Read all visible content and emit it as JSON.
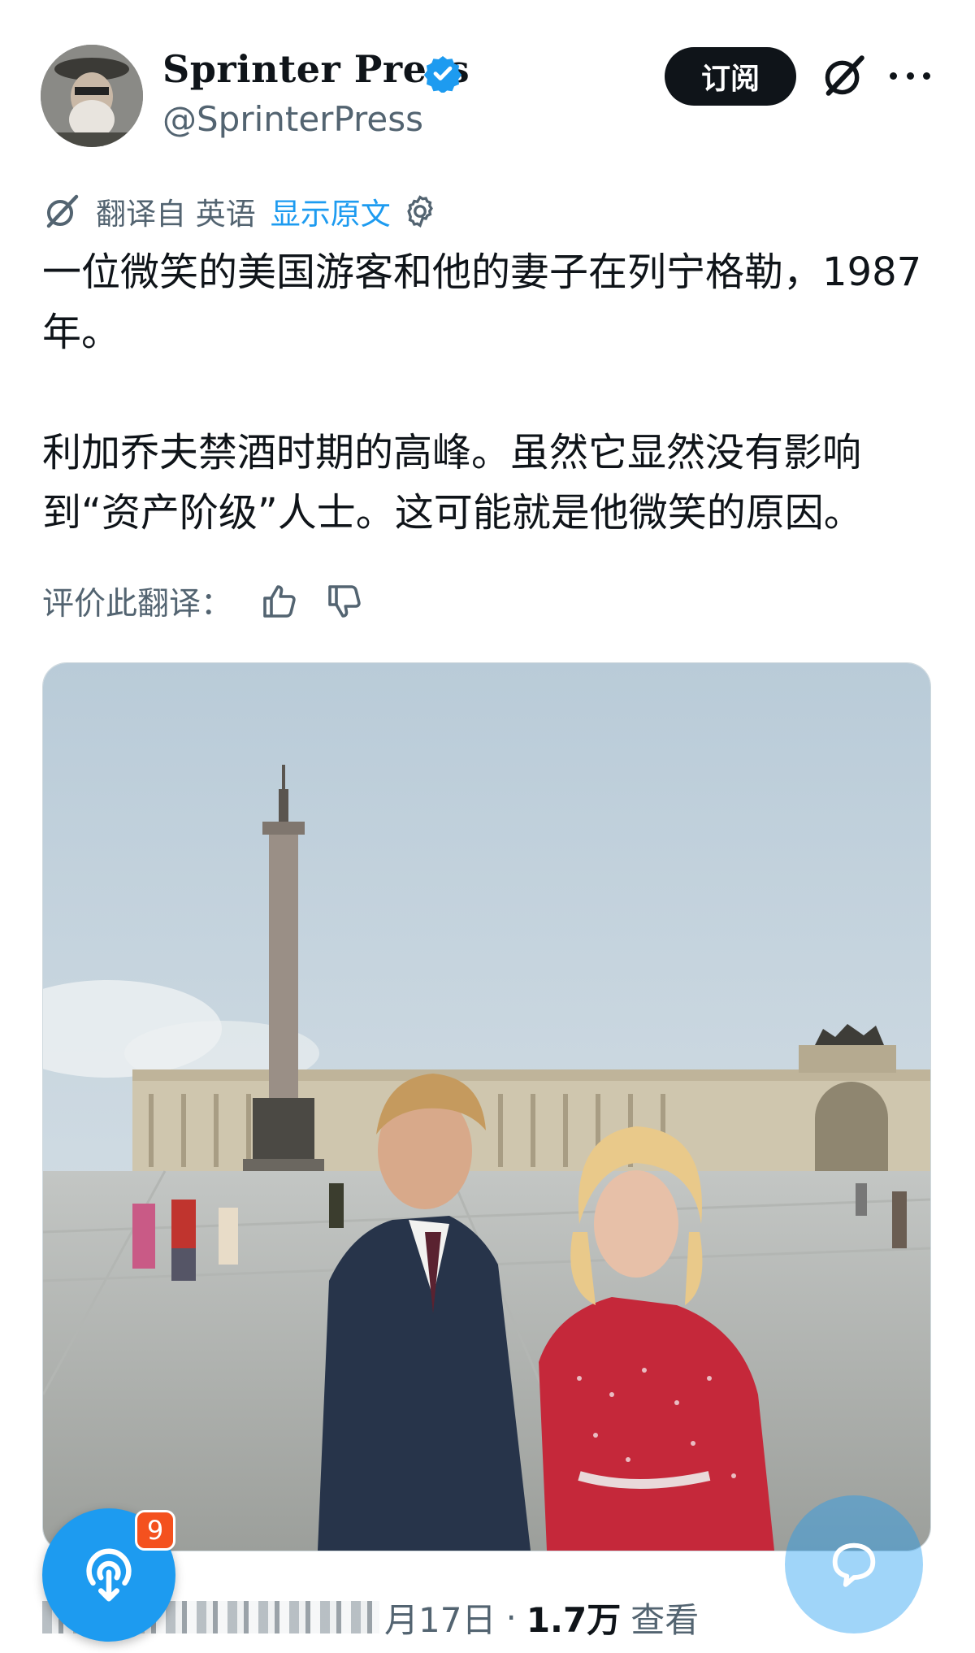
{
  "header": {
    "display_name": "Sprinter Press",
    "handle": "@SprinterPress",
    "subscribe_label": "订阅"
  },
  "translation": {
    "translated_from": "翻译自 英语",
    "show_original": "显示原文"
  },
  "post": {
    "paragraph_1": "一位微笑的美国游客和他的妻子在列宁格勒，1987年。",
    "paragraph_2": "利加乔夫禁酒时期的高峰。虽然它显然没有影响到“资产阶级”人士。这可能就是他微笑的原因。"
  },
  "rate": {
    "label": "评价此翻译："
  },
  "meta": {
    "date_partial": "月17日",
    "separator": "·",
    "views_count": "1.7万",
    "views_label": "查看"
  },
  "spaces_badge": "9",
  "colors": {
    "accent": "#1d9bf0",
    "text_primary": "#0f1419",
    "text_secondary": "#536471",
    "badge": "#f4511e"
  },
  "icons": [
    "verified-badge-icon",
    "grok-icon",
    "more-icon",
    "translate-icon",
    "gear-icon",
    "thumbs-up-icon",
    "thumbs-down-icon",
    "spaces-icon",
    "chat-bubble-icon"
  ]
}
